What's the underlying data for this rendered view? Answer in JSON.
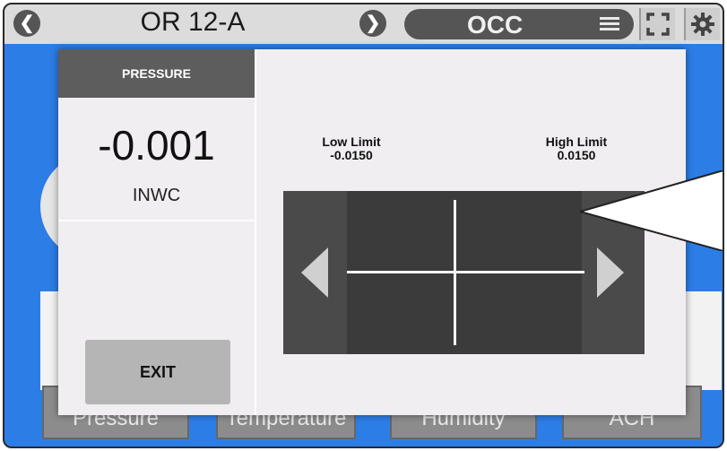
{
  "header": {
    "prev_icon": "chevron-left-icon",
    "room_title": "OR 12-A",
    "next_icon": "chevron-right-icon",
    "occupancy_label": "OCC",
    "menu_icon": "hamburger-menu-icon",
    "fullscreen_icon": "fullscreen-icon",
    "settings_icon": "gear-icon"
  },
  "background": {
    "tabs": [
      "Pressure",
      "Temperature",
      "Humidity",
      "ACH"
    ]
  },
  "modal": {
    "title": "PRESSURE",
    "value": "-0.001",
    "unit": "INWC",
    "exit_label": "EXIT",
    "low_limit_label": "Low Limit",
    "low_limit_value": "-0.0150",
    "high_limit_label": "High Limit",
    "high_limit_value": "0.0150",
    "adjust_left_icon": "triangle-left-icon",
    "adjust_right_icon": "triangle-right-icon"
  },
  "colors": {
    "background_blue": "#2d7de6",
    "header_dark": "#5d5d5d",
    "graph_dark": "#4a4a4a",
    "modal_bg": "#f1eef1"
  }
}
